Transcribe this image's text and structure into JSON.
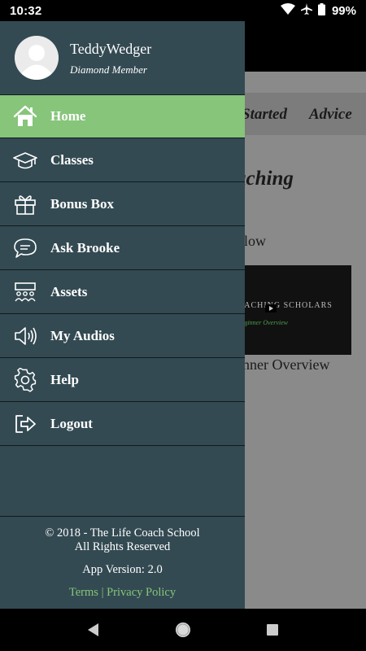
{
  "status_bar": {
    "time": "10:32",
    "battery": "99%"
  },
  "background_app": {
    "tabs": [
      "Started",
      "Advice"
    ],
    "heading": "aching",
    "below_text": "elow",
    "video_title": "OACHING SCHOLARS",
    "video_subtitle": "Beginner Overview",
    "video_caption": "nner Overview"
  },
  "drawer": {
    "user": {
      "name": "TeddyWedger",
      "membership": "Diamond Member"
    },
    "menu": [
      {
        "label": "Home",
        "icon": "home-icon",
        "active": true
      },
      {
        "label": "Classes",
        "icon": "graduation-cap-icon",
        "active": false
      },
      {
        "label": "Bonus Box",
        "icon": "gift-icon",
        "active": false
      },
      {
        "label": "Ask Brooke",
        "icon": "chat-bubble-icon",
        "active": false
      },
      {
        "label": "Assets",
        "icon": "audience-icon",
        "active": false
      },
      {
        "label": "My Audios",
        "icon": "speaker-icon",
        "active": false
      },
      {
        "label": "Help",
        "icon": "gear-icon",
        "active": false
      },
      {
        "label": "Logout",
        "icon": "logout-icon",
        "active": false
      }
    ],
    "footer": {
      "copyright_line1": "© 2018 - The Life Coach School",
      "copyright_line2": "All Rights Reserved",
      "version": "App Version: 2.0",
      "terms": "Terms",
      "separator": "|",
      "privacy": "Privacy Policy"
    }
  },
  "colors": {
    "drawer_bg": "#334a52",
    "active_item": "#86c57a",
    "link_green": "#86c57a"
  }
}
